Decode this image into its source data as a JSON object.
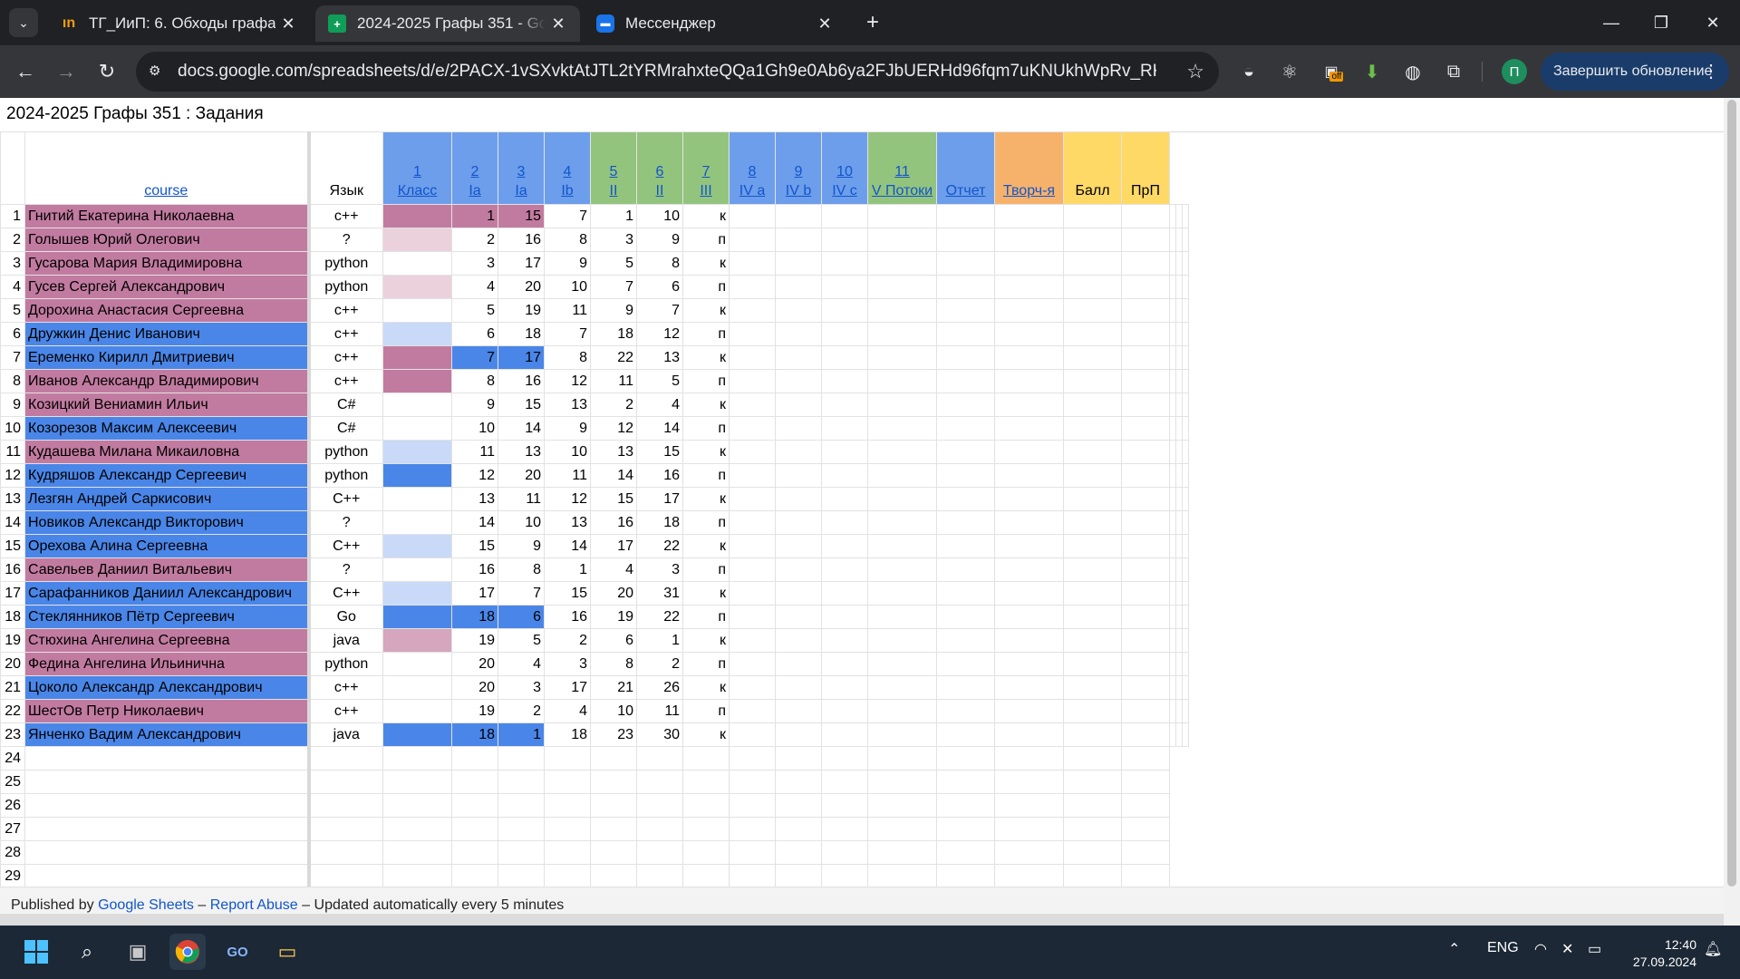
{
  "browser": {
    "tabs": [
      {
        "title": "ТГ_ИиП: 6. Обходы графа II",
        "icon": "informatics-icon",
        "active": false
      },
      {
        "title": "2024-2025 Графы 351 - Google Sheets",
        "icon": "google-sheets-icon",
        "active": true
      },
      {
        "title": "Мессенджер",
        "icon": "messenger-icon",
        "active": false
      }
    ],
    "url": "docs.google.com/spreadsheets/d/e/2PACX-1vSXvktAtJTL2tYRMrahxteQQa1Gh9e0Ab6ya2FJbUERHd96fqm7uKNUkhWpRv_RKYWWaVE480K...",
    "profile_initial": "П",
    "update_label": "Завершить обновление",
    "extension_badge": "off"
  },
  "page": {
    "title": "2024-2025 Графы 351 : Задания",
    "headers": {
      "course": "course",
      "lang": "Язык",
      "cols": [
        {
          "num": "1",
          "sub": "Класс"
        },
        {
          "num": "2",
          "sub": "Ia"
        },
        {
          "num": "3",
          "sub": "Ia"
        },
        {
          "num": "4",
          "sub": "Ib"
        },
        {
          "num": "5",
          "sub": "II"
        },
        {
          "num": "6",
          "sub": "II"
        },
        {
          "num": "7",
          "sub": "III"
        },
        {
          "num": "8",
          "sub": "IV a"
        },
        {
          "num": "9",
          "sub": "IV b"
        },
        {
          "num": "10",
          "sub": "IV c"
        },
        {
          "num": "11",
          "sub": "V Потоки"
        }
      ],
      "report": "Отчет",
      "creative": "Творч-я",
      "score": "Балл",
      "prp": "ПрП"
    },
    "colors": {
      "pink": "#c27ba0",
      "blue": "#4a86e8",
      "header_blue": "#6d9eeb",
      "header_green": "#93c47d",
      "header_orange": "#f6b26b",
      "header_yellow": "#ffd966"
    },
    "rows": [
      {
        "n": "1",
        "name": "Гнитий Екатерина Николаевна",
        "lang": "c++",
        "c2": "1",
        "c3": "15",
        "c4": "7",
        "c5": "1",
        "c6": "10",
        "c7": "к"
      },
      {
        "n": "2",
        "name": "Голышев Юрий Олегович",
        "lang": "?",
        "c2": "2",
        "c3": "16",
        "c4": "8",
        "c5": "3",
        "c6": "9",
        "c7": "п"
      },
      {
        "n": "3",
        "name": "Гусарова Мария Владимировна",
        "lang": "python",
        "c2": "3",
        "c3": "17",
        "c4": "9",
        "c5": "5",
        "c6": "8",
        "c7": "к"
      },
      {
        "n": "4",
        "name": "Гусев Сергей Александрович",
        "lang": "python",
        "c2": "4",
        "c3": "20",
        "c4": "10",
        "c5": "7",
        "c6": "6",
        "c7": "п"
      },
      {
        "n": "5",
        "name": "Дорохина Анастасия Сергеевна",
        "lang": "c++",
        "c2": "5",
        "c3": "19",
        "c4": "11",
        "c5": "9",
        "c6": "7",
        "c7": "к"
      },
      {
        "n": "6",
        "name": "Дружкин Денис Иванович",
        "lang": "c++",
        "c2": "6",
        "c3": "18",
        "c4": "7",
        "c5": "18",
        "c6": "12",
        "c7": "п"
      },
      {
        "n": "7",
        "name": "Еременко Кирилл Дмитриевич",
        "lang": "c++",
        "c2": "7",
        "c3": "17",
        "c4": "8",
        "c5": "22",
        "c6": "13",
        "c7": "к"
      },
      {
        "n": "8",
        "name": "Иванов Александр Владимирович",
        "lang": "c++",
        "c2": "8",
        "c3": "16",
        "c4": "12",
        "c5": "11",
        "c6": "5",
        "c7": "п"
      },
      {
        "n": "9",
        "name": "Козицкий Вениамин Ильич",
        "lang": "C#",
        "c2": "9",
        "c3": "15",
        "c4": "13",
        "c5": "2",
        "c6": "4",
        "c7": "к"
      },
      {
        "n": "10",
        "name": "Козорезов Максим Алексеевич",
        "lang": "C#",
        "c2": "10",
        "c3": "14",
        "c4": "9",
        "c5": "12",
        "c6": "14",
        "c7": "п"
      },
      {
        "n": "11",
        "name": "Кудашева Милана Микаиловна",
        "lang": "python",
        "c2": "11",
        "c3": "13",
        "c4": "10",
        "c5": "13",
        "c6": "15",
        "c7": "к"
      },
      {
        "n": "12",
        "name": "Кудряшов Александр Сергеевич",
        "lang": "python",
        "c2": "12",
        "c3": "20",
        "c4": "11",
        "c5": "14",
        "c6": "16",
        "c7": "п"
      },
      {
        "n": "13",
        "name": "Лезгян Андрей Саркисович",
        "lang": "C++",
        "c2": "13",
        "c3": "11",
        "c4": "12",
        "c5": "15",
        "c6": "17",
        "c7": "к"
      },
      {
        "n": "14",
        "name": "Новиков Александр Викторович",
        "lang": "?",
        "c2": "14",
        "c3": "10",
        "c4": "13",
        "c5": "16",
        "c6": "18",
        "c7": "п"
      },
      {
        "n": "15",
        "name": "Орехова Алина Сергеевна",
        "lang": "C++",
        "c2": "15",
        "c3": "9",
        "c4": "14",
        "c5": "17",
        "c6": "22",
        "c7": "к"
      },
      {
        "n": "16",
        "name": "Савельев Даниил Витальевич",
        "lang": "?",
        "c2": "16",
        "c3": "8",
        "c4": "1",
        "c5": "4",
        "c6": "3",
        "c7": "п"
      },
      {
        "n": "17",
        "name": "Сарафанников Даниил Александрович",
        "lang": "C++",
        "c2": "17",
        "c3": "7",
        "c4": "15",
        "c5": "20",
        "c6": "31",
        "c7": "к"
      },
      {
        "n": "18",
        "name": "Стеклянников Пётр Сергеевич",
        "lang": "Go",
        "c2": "18",
        "c3": "6",
        "c4": "16",
        "c5": "19",
        "c6": "22",
        "c7": "п"
      },
      {
        "n": "19",
        "name": "Стюхина Ангелина Сергеевна",
        "lang": "java",
        "c2": "19",
        "c3": "5",
        "c4": "2",
        "c5": "6",
        "c6": "1",
        "c7": "к"
      },
      {
        "n": "20",
        "name": "Федина Ангелина Ильинична",
        "lang": "python",
        "c2": "20",
        "c3": "4",
        "c4": "3",
        "c5": "8",
        "c6": "2",
        "c7": "п"
      },
      {
        "n": "21",
        "name": "Цоколо Александр Александрович",
        "lang": "c++",
        "c2": "20",
        "c3": "3",
        "c4": "17",
        "c5": "21",
        "c6": "26",
        "c7": "к"
      },
      {
        "n": "22",
        "name": "ШестОв Петр Николаевич",
        "lang": "c++",
        "c2": "19",
        "c3": "2",
        "c4": "4",
        "c5": "10",
        "c6": "11",
        "c7": "п"
      },
      {
        "n": "23",
        "name": "Янченко Вадим Александрович",
        "lang": "java",
        "c2": "18",
        "c3": "1",
        "c4": "18",
        "c5": "23",
        "c6": "30",
        "c7": "к"
      }
    ],
    "empty_rows": [
      "24",
      "25",
      "26",
      "27",
      "28",
      "29"
    ],
    "footer": {
      "published_by": "Published by",
      "sheets_link": "Google Sheets",
      "dash1": "–",
      "report_link": "Report Abuse",
      "dash2": "–",
      "updated": "Updated automatically every 5 minutes"
    }
  },
  "taskbar": {
    "lang": "ENG",
    "time": "12:40",
    "date": "27.09.2024"
  }
}
